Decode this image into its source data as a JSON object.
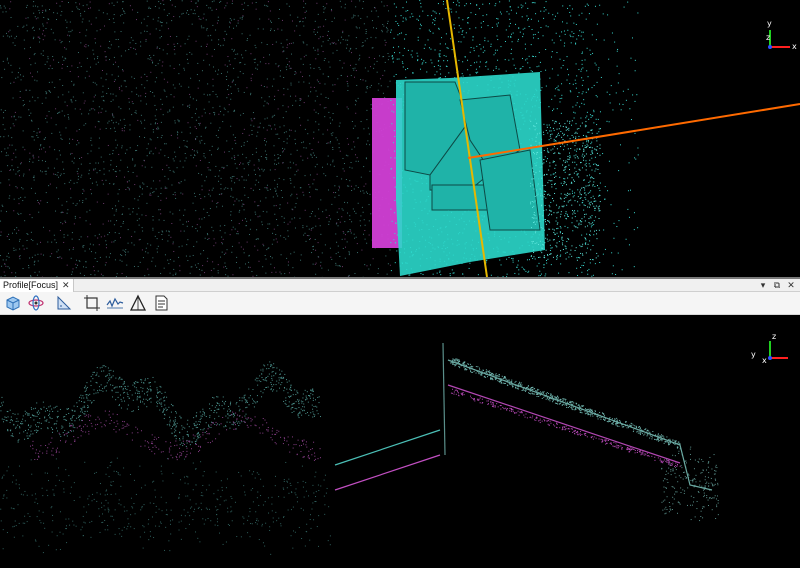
{
  "panel": {
    "tab_title": "Profile[Focus]",
    "close_glyph": "✕",
    "header_controls": [
      {
        "name": "dropdown-arrow-icon",
        "glyph": "▾"
      },
      {
        "name": "restore-window-icon",
        "glyph": "⧉"
      },
      {
        "name": "close-panel-icon",
        "glyph": "✕"
      }
    ]
  },
  "toolbar": {
    "tools": [
      {
        "name": "3d-view-tool",
        "icon": "cube-icon"
      },
      {
        "name": "rotate-tool",
        "icon": "orbit-icon"
      },
      {
        "name": "measure-tool",
        "icon": "triangle-ruler-icon"
      },
      {
        "name": "clip-box-tool",
        "icon": "crop-icon"
      },
      {
        "name": "profile-tool",
        "icon": "profile-wave-icon"
      },
      {
        "name": "triangulate-tool",
        "icon": "triangle-icon"
      },
      {
        "name": "report-tool",
        "icon": "document-icon"
      }
    ]
  },
  "axes": {
    "labels": [
      "y",
      "x",
      "z"
    ],
    "colors": {
      "x": "#ff2020",
      "y": "#20d020",
      "z": "#3050ff"
    }
  },
  "colors": {
    "cyan_points": "#39d8cf",
    "magenta_points": "#e040e0",
    "profile_line_yellow": "#e6b800",
    "profile_line_orange": "#ff6a00",
    "background": "#000000"
  }
}
